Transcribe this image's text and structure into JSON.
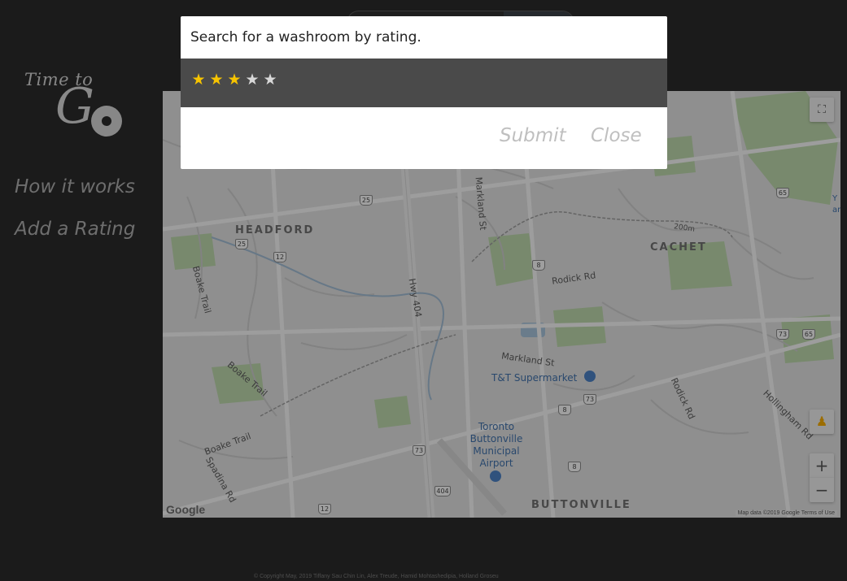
{
  "logo": {
    "line1": "Time to",
    "line2": "G"
  },
  "nav": {
    "items": [
      {
        "label": "How it works"
      },
      {
        "label": "Add a Rating"
      }
    ]
  },
  "modal": {
    "title": "Search for a washroom by rating.",
    "rating": {
      "value": 3,
      "max": 5,
      "filled_color": "#f7c400",
      "empty_color": "#d8d8d8"
    },
    "submit_label": "Submit",
    "close_label": "Close"
  },
  "map": {
    "areas": [
      "HEADFORD",
      "CACHET",
      "BUTTONVILLE"
    ],
    "roads": [
      "Markland St",
      "Boake Trail",
      "Hwy 404",
      "Rodick Rd",
      "Markland St",
      "Boake Trail",
      "Rodick Rd",
      "Hollingham Rd",
      "Boake Trail",
      "Spadina Rd"
    ],
    "contour": "200m",
    "pois": {
      "supermarket": "T&T Supermarket",
      "airport": "Toronto Buttonville Municipal Airport"
    },
    "shields": [
      "25",
      "25",
      "12",
      "8",
      "65",
      "73",
      "65",
      "73",
      "8",
      "73",
      "8",
      "404",
      "12"
    ],
    "controls": {
      "fullscreen_icon": "fullscreen-icon",
      "pegman_icon": "pegman-icon",
      "zoom_in": "+",
      "zoom_out": "−"
    },
    "google_logo": "Google",
    "attribution": "Map data ©2019 Google   Terms of Use",
    "cut_label": "Y an"
  },
  "footer": {
    "text": "© Copyright May, 2019 Tiffany Sau Chin Lin, Alex Treude, Hamid Mohtashedipia, Holland Groseu"
  },
  "colors": {
    "background": "#2a2a2a",
    "modal_body": "#4a4a4a",
    "star_on": "#f7c400"
  }
}
